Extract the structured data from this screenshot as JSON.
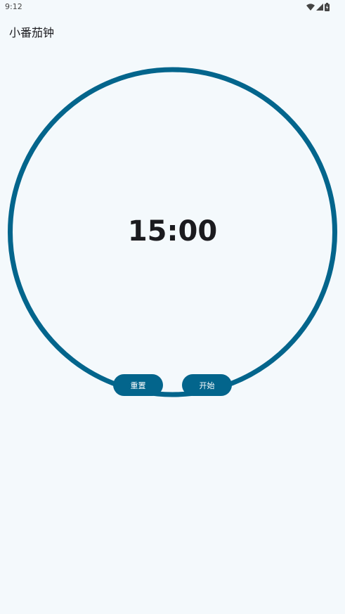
{
  "status_bar": {
    "time": "9:12",
    "icons": [
      "wifi-icon",
      "cellular-signal-icon",
      "battery-charging-icon"
    ]
  },
  "app_bar": {
    "title": "小番茄钟"
  },
  "timer": {
    "display": "15:00"
  },
  "controls": {
    "reset_label": "重置",
    "start_label": "开始"
  },
  "colors": {
    "background": "#f4f9fc",
    "accent": "#03658c",
    "text": "#1b1b1f",
    "button_text": "#ffffff"
  }
}
